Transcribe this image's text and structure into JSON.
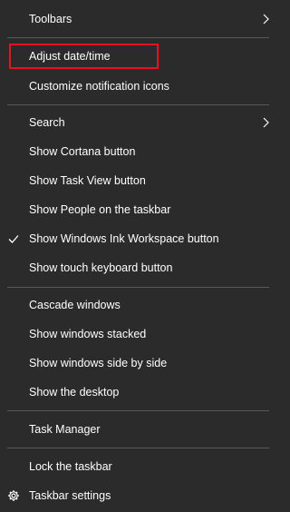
{
  "menu": {
    "items": {
      "toolbars": {
        "label": "Toolbars",
        "right_icon": "chevron-right-icon"
      },
      "adjust_datetime": {
        "label": "Adjust date/time",
        "highlighted": true
      },
      "customize_icons": {
        "label": "Customize notification icons"
      },
      "search": {
        "label": "Search",
        "right_icon": "chevron-right-icon"
      },
      "show_cortana": {
        "label": "Show Cortana button"
      },
      "show_taskview": {
        "label": "Show Task View button"
      },
      "show_people": {
        "label": "Show People on the taskbar"
      },
      "show_ink": {
        "label": "Show Windows Ink Workspace button",
        "checked": true,
        "left_icon": "checkmark-icon"
      },
      "show_touchkb": {
        "label": "Show touch keyboard button"
      },
      "cascade": {
        "label": "Cascade windows"
      },
      "stacked": {
        "label": "Show windows stacked"
      },
      "side_by_side": {
        "label": "Show windows side by side"
      },
      "show_desktop": {
        "label": "Show the desktop"
      },
      "task_manager": {
        "label": "Task Manager"
      },
      "lock_taskbar": {
        "label": "Lock the taskbar"
      },
      "taskbar_settings": {
        "label": "Taskbar settings",
        "left_icon": "gear-icon"
      }
    }
  },
  "colors": {
    "background": "#2b2b2b",
    "text": "#ffffff",
    "separator": "#5a5a5a",
    "highlight_border": "#e81123"
  }
}
